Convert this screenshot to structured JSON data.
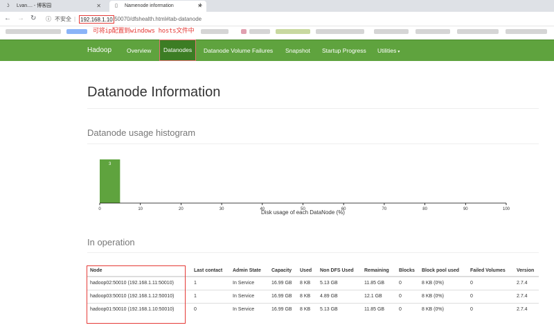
{
  "browser": {
    "tabs": [
      {
        "label": "Lvan.... - 博客园",
        "icon": "ring-icon"
      },
      {
        "label": "Namenode information",
        "icon": "page-icon"
      }
    ],
    "new_tab": "+",
    "security": "不安全",
    "url_host": "192.168.1.10",
    "url_rest": ":50070/dfshealth.html#tab-datanode",
    "annotation": "可将ip配置到windows hosts文件中"
  },
  "navbar": {
    "brand": "Hadoop",
    "items": [
      "Overview",
      "Datanodes",
      "Datanode Volume Failures",
      "Snapshot",
      "Startup Progress",
      "Utilities"
    ],
    "active": "Datanodes",
    "color": "#5fa33e"
  },
  "page": {
    "title": "Datanode Information",
    "histogram_title": "Datanode usage histogram",
    "in_operation_title": "In operation"
  },
  "chart_data": {
    "type": "bar",
    "xlabel": "Disk usage of each DataNode (%)",
    "ticks": [
      "0",
      "10",
      "20",
      "30",
      "40",
      "50",
      "60",
      "70",
      "80",
      "90",
      "100"
    ],
    "xlim": [
      0,
      100
    ],
    "bins": [
      {
        "x0": 0,
        "x1": 5,
        "count": 3,
        "label": "3"
      }
    ],
    "bar_color": "#5fa33e"
  },
  "table": {
    "headers": [
      "Node",
      "Last contact",
      "Admin State",
      "Capacity",
      "Used",
      "Non DFS Used",
      "Remaining",
      "Blocks",
      "Block pool used",
      "Failed Volumes",
      "Version"
    ],
    "rows": [
      [
        "hadoop02:50010 (192.168.1.11:50010)",
        "1",
        "In Service",
        "16.99 GB",
        "8 KB",
        "5.13 GB",
        "11.85 GB",
        "0",
        "8 KB (0%)",
        "0",
        "2.7.4"
      ],
      [
        "hadoop03:50010 (192.168.1.12:50010)",
        "1",
        "In Service",
        "16.99 GB",
        "8 KB",
        "4.89 GB",
        "12.1 GB",
        "0",
        "8 KB (0%)",
        "0",
        "2.7.4"
      ],
      [
        "hadoop01:50010 (192.168.1.10:50010)",
        "0",
        "In Service",
        "16.99 GB",
        "8 KB",
        "5.13 GB",
        "11.85 GB",
        "0",
        "8 KB (0%)",
        "0",
        "2.7.4"
      ]
    ]
  }
}
